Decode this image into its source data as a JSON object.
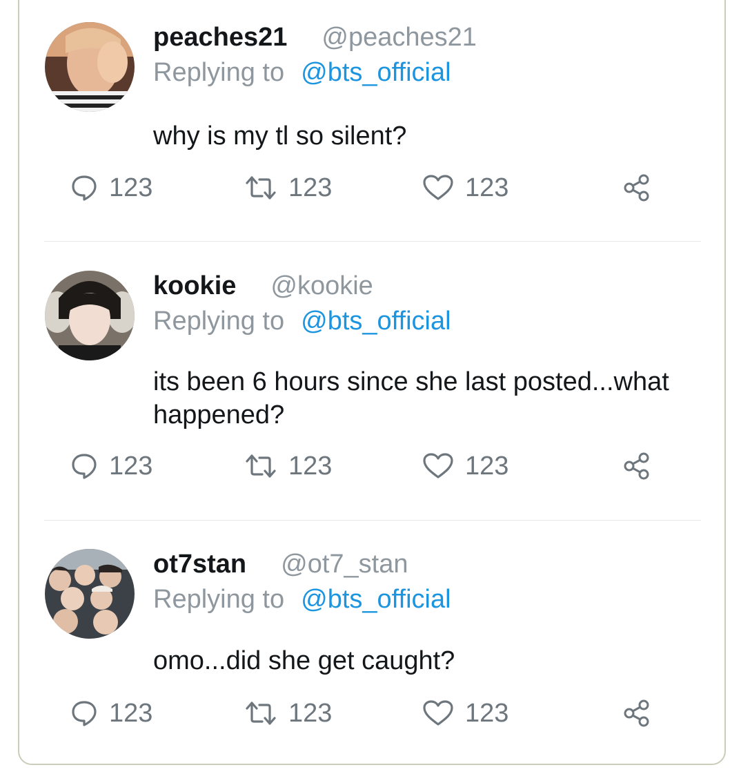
{
  "tweets": [
    {
      "display_name": "peaches21",
      "handle": "@peaches21",
      "replying_label": "Replying to",
      "replying_to": "@bts_official",
      "text": "why is my tl so silent?",
      "replies": "123",
      "retweets": "123",
      "likes": "123"
    },
    {
      "display_name": "kookie",
      "handle": "@kookie",
      "replying_label": "Replying to",
      "replying_to": "@bts_official",
      "text": "its been 6 hours since she last posted...what happened?",
      "replies": "123",
      "retweets": "123",
      "likes": "123"
    },
    {
      "display_name": "ot7stan",
      "handle": "@ot7_stan",
      "replying_label": "Replying to",
      "replying_to": "@bts_official",
      "text": "omo...did she get caught?",
      "replies": "123",
      "retweets": "123",
      "likes": "123"
    }
  ],
  "icons": {
    "reply": "reply-icon",
    "retweet": "retweet-icon",
    "like": "heart-icon",
    "share": "share-icon"
  },
  "colors": {
    "name": "#14171a",
    "handle": "#8f979e",
    "link": "#1b95e0",
    "action": "#6e767d",
    "card_border": "#c9cdb8"
  }
}
